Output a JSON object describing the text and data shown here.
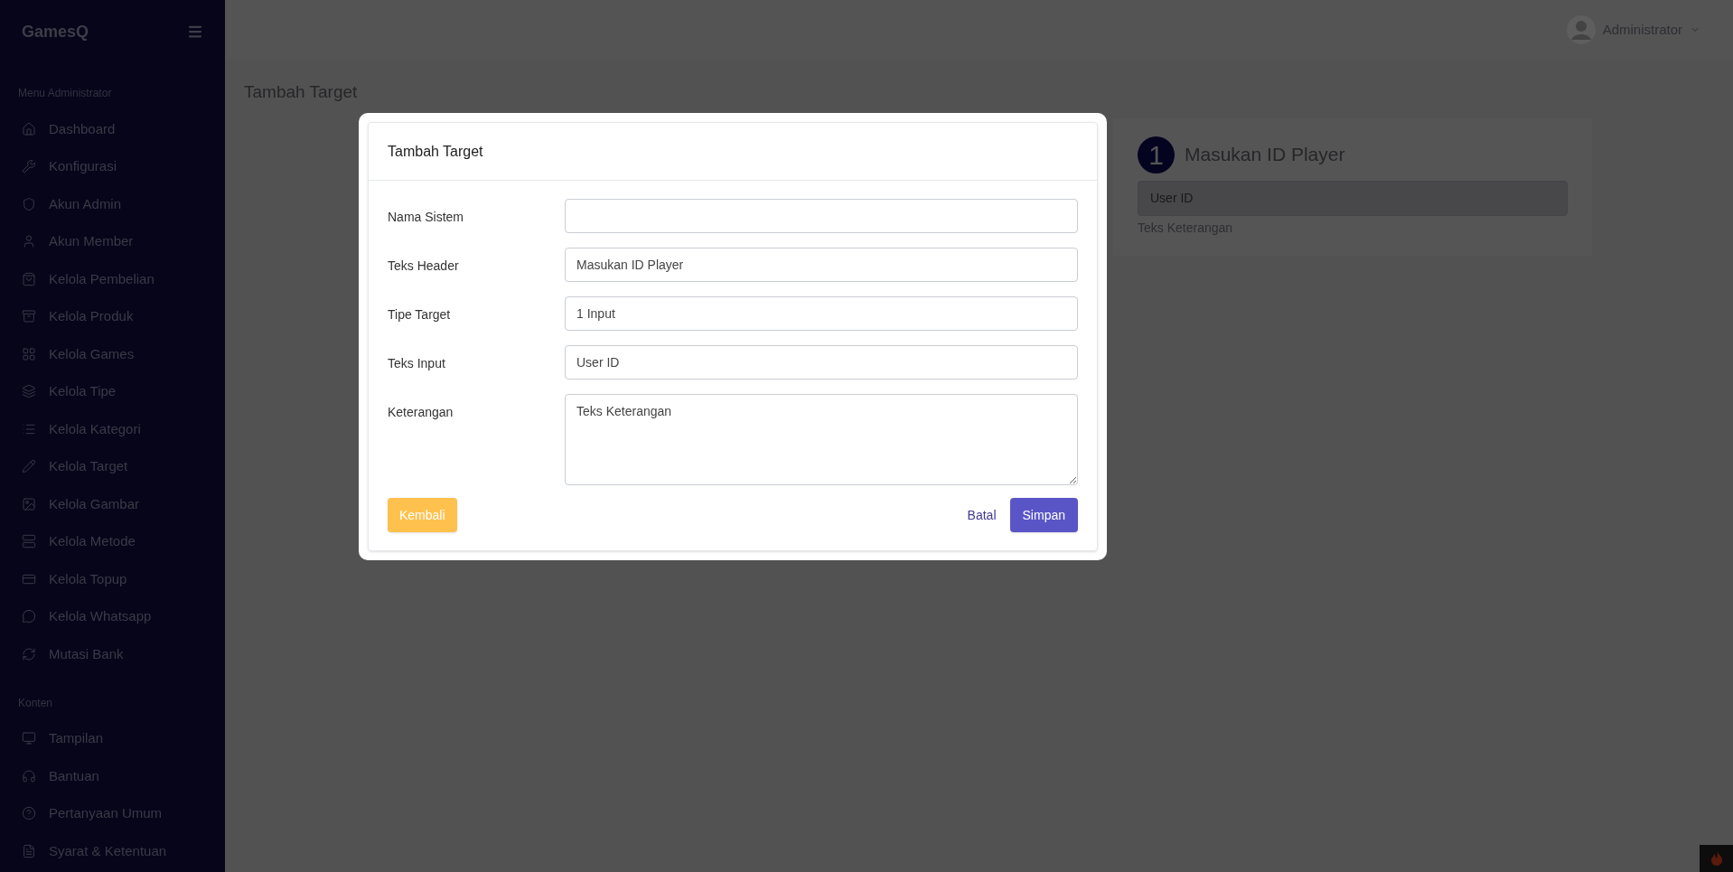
{
  "brand": "GamesQ",
  "sidebar": {
    "sections": [
      {
        "heading": "Menu Administrator",
        "items": [
          {
            "label": "Dashboard"
          },
          {
            "label": "Konfigurasi"
          },
          {
            "label": "Akun Admin"
          },
          {
            "label": "Akun Member"
          },
          {
            "label": "Kelola Pembelian"
          },
          {
            "label": "Kelola Produk"
          },
          {
            "label": "Kelola Games"
          },
          {
            "label": "Kelola Tipe"
          },
          {
            "label": "Kelola Kategori"
          },
          {
            "label": "Kelola Target"
          },
          {
            "label": "Kelola Gambar"
          },
          {
            "label": "Kelola Metode"
          },
          {
            "label": "Kelola Topup"
          },
          {
            "label": "Kelola Whatsapp"
          },
          {
            "label": "Mutasi Bank"
          }
        ]
      },
      {
        "heading": "Konten",
        "items": [
          {
            "label": "Tampilan"
          },
          {
            "label": "Bantuan"
          },
          {
            "label": "Pertanyaan Umum"
          },
          {
            "label": "Syarat & Ketentuan"
          }
        ]
      }
    ]
  },
  "user": {
    "name": "Administrator"
  },
  "page_title": "Tambah Target",
  "preview": {
    "step": "1",
    "header": "Masukan ID Player",
    "input_placeholder": "User ID",
    "note": "Teks Keterangan"
  },
  "modal": {
    "title": "Tambah Target",
    "fields": [
      {
        "label": "Nama Sistem",
        "kind": "input"
      },
      {
        "label": "Teks Header",
        "kind": "input",
        "value": "Masukan ID Player"
      },
      {
        "label": "Tipe Target",
        "kind": "input",
        "value": "1 Input"
      },
      {
        "label": "Teks Input",
        "kind": "input",
        "value": "User ID"
      },
      {
        "label": "Keterangan",
        "kind": "textarea",
        "value": "Teks Keterangan"
      }
    ],
    "back_button": "Kembali",
    "cancel_link": "Batal",
    "save_button": "Simpan"
  }
}
